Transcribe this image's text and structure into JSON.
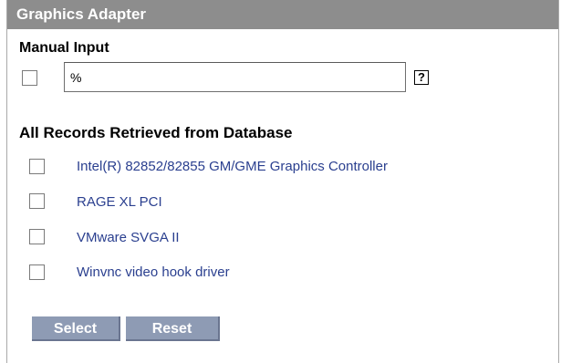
{
  "panel": {
    "title": "Graphics Adapter"
  },
  "manual_input": {
    "label": "Manual Input",
    "value": "%",
    "help_icon": "?"
  },
  "records": {
    "label": "All Records Retrieved from Database",
    "items": [
      {
        "label": "Intel(R) 82852/82855 GM/GME Graphics Controller"
      },
      {
        "label": "RAGE XL PCI"
      },
      {
        "label": "VMware SVGA II"
      },
      {
        "label": "Winvnc video hook driver"
      }
    ]
  },
  "buttons": {
    "select_label": "Select",
    "reset_label": "Reset"
  },
  "colors": {
    "header_bg": "#8d8d8d",
    "link": "#2a3f8f",
    "button_bg": "#8e9bb4"
  }
}
